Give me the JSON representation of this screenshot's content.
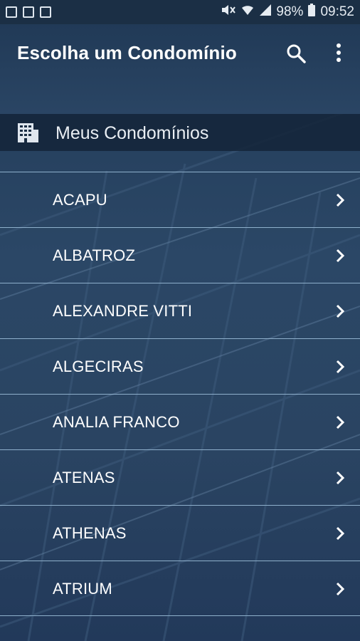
{
  "status_bar": {
    "battery": "98%",
    "time": "09:52",
    "icons": [
      "gallery-icon",
      "photo-icon",
      "image-icon",
      "mute-icon",
      "wifi-icon",
      "signal-icon",
      "battery-icon"
    ]
  },
  "app_bar": {
    "title": "Escolha um Condomínio",
    "icons": [
      "search-icon",
      "more-vert-icon"
    ]
  },
  "section": {
    "icon": "building-icon",
    "label": "Meus Condomínios"
  },
  "condominios": [
    {
      "label": "ACAPU"
    },
    {
      "label": "ALBATROZ"
    },
    {
      "label": "ALEXANDRE VITTI"
    },
    {
      "label": "ALGECIRAS"
    },
    {
      "label": "ANALIA FRANCO"
    },
    {
      "label": "ATENAS"
    },
    {
      "label": "ATHENAS"
    },
    {
      "label": "ATRIUM"
    }
  ],
  "colors": {
    "background": "#2a4462",
    "status_bar": "#1b2f45",
    "divider": "#8fb0cc",
    "text": "#ffffff"
  }
}
